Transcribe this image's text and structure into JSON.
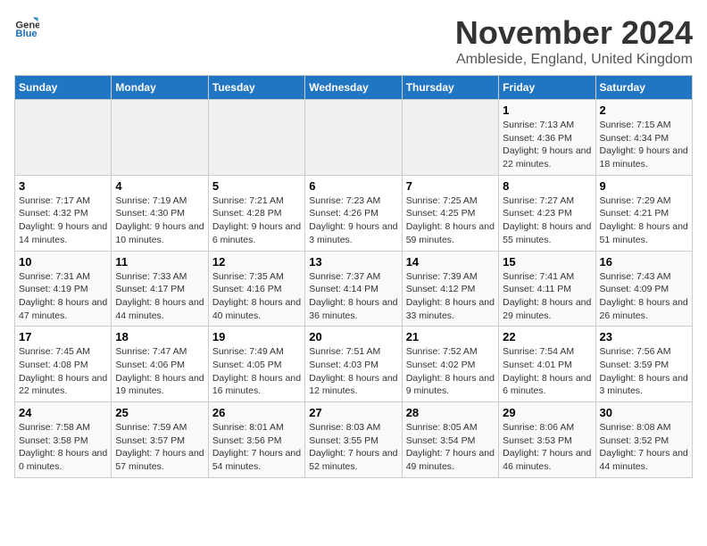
{
  "logo": {
    "general": "General",
    "blue": "Blue"
  },
  "title": "November 2024",
  "location": "Ambleside, England, United Kingdom",
  "days_of_week": [
    "Sunday",
    "Monday",
    "Tuesday",
    "Wednesday",
    "Thursday",
    "Friday",
    "Saturday"
  ],
  "weeks": [
    [
      {
        "day": "",
        "info": ""
      },
      {
        "day": "",
        "info": ""
      },
      {
        "day": "",
        "info": ""
      },
      {
        "day": "",
        "info": ""
      },
      {
        "day": "",
        "info": ""
      },
      {
        "day": "1",
        "info": "Sunrise: 7:13 AM\nSunset: 4:36 PM\nDaylight: 9 hours and 22 minutes."
      },
      {
        "day": "2",
        "info": "Sunrise: 7:15 AM\nSunset: 4:34 PM\nDaylight: 9 hours and 18 minutes."
      }
    ],
    [
      {
        "day": "3",
        "info": "Sunrise: 7:17 AM\nSunset: 4:32 PM\nDaylight: 9 hours and 14 minutes."
      },
      {
        "day": "4",
        "info": "Sunrise: 7:19 AM\nSunset: 4:30 PM\nDaylight: 9 hours and 10 minutes."
      },
      {
        "day": "5",
        "info": "Sunrise: 7:21 AM\nSunset: 4:28 PM\nDaylight: 9 hours and 6 minutes."
      },
      {
        "day": "6",
        "info": "Sunrise: 7:23 AM\nSunset: 4:26 PM\nDaylight: 9 hours and 3 minutes."
      },
      {
        "day": "7",
        "info": "Sunrise: 7:25 AM\nSunset: 4:25 PM\nDaylight: 8 hours and 59 minutes."
      },
      {
        "day": "8",
        "info": "Sunrise: 7:27 AM\nSunset: 4:23 PM\nDaylight: 8 hours and 55 minutes."
      },
      {
        "day": "9",
        "info": "Sunrise: 7:29 AM\nSunset: 4:21 PM\nDaylight: 8 hours and 51 minutes."
      }
    ],
    [
      {
        "day": "10",
        "info": "Sunrise: 7:31 AM\nSunset: 4:19 PM\nDaylight: 8 hours and 47 minutes."
      },
      {
        "day": "11",
        "info": "Sunrise: 7:33 AM\nSunset: 4:17 PM\nDaylight: 8 hours and 44 minutes."
      },
      {
        "day": "12",
        "info": "Sunrise: 7:35 AM\nSunset: 4:16 PM\nDaylight: 8 hours and 40 minutes."
      },
      {
        "day": "13",
        "info": "Sunrise: 7:37 AM\nSunset: 4:14 PM\nDaylight: 8 hours and 36 minutes."
      },
      {
        "day": "14",
        "info": "Sunrise: 7:39 AM\nSunset: 4:12 PM\nDaylight: 8 hours and 33 minutes."
      },
      {
        "day": "15",
        "info": "Sunrise: 7:41 AM\nSunset: 4:11 PM\nDaylight: 8 hours and 29 minutes."
      },
      {
        "day": "16",
        "info": "Sunrise: 7:43 AM\nSunset: 4:09 PM\nDaylight: 8 hours and 26 minutes."
      }
    ],
    [
      {
        "day": "17",
        "info": "Sunrise: 7:45 AM\nSunset: 4:08 PM\nDaylight: 8 hours and 22 minutes."
      },
      {
        "day": "18",
        "info": "Sunrise: 7:47 AM\nSunset: 4:06 PM\nDaylight: 8 hours and 19 minutes."
      },
      {
        "day": "19",
        "info": "Sunrise: 7:49 AM\nSunset: 4:05 PM\nDaylight: 8 hours and 16 minutes."
      },
      {
        "day": "20",
        "info": "Sunrise: 7:51 AM\nSunset: 4:03 PM\nDaylight: 8 hours and 12 minutes."
      },
      {
        "day": "21",
        "info": "Sunrise: 7:52 AM\nSunset: 4:02 PM\nDaylight: 8 hours and 9 minutes."
      },
      {
        "day": "22",
        "info": "Sunrise: 7:54 AM\nSunset: 4:01 PM\nDaylight: 8 hours and 6 minutes."
      },
      {
        "day": "23",
        "info": "Sunrise: 7:56 AM\nSunset: 3:59 PM\nDaylight: 8 hours and 3 minutes."
      }
    ],
    [
      {
        "day": "24",
        "info": "Sunrise: 7:58 AM\nSunset: 3:58 PM\nDaylight: 8 hours and 0 minutes."
      },
      {
        "day": "25",
        "info": "Sunrise: 7:59 AM\nSunset: 3:57 PM\nDaylight: 7 hours and 57 minutes."
      },
      {
        "day": "26",
        "info": "Sunrise: 8:01 AM\nSunset: 3:56 PM\nDaylight: 7 hours and 54 minutes."
      },
      {
        "day": "27",
        "info": "Sunrise: 8:03 AM\nSunset: 3:55 PM\nDaylight: 7 hours and 52 minutes."
      },
      {
        "day": "28",
        "info": "Sunrise: 8:05 AM\nSunset: 3:54 PM\nDaylight: 7 hours and 49 minutes."
      },
      {
        "day": "29",
        "info": "Sunrise: 8:06 AM\nSunset: 3:53 PM\nDaylight: 7 hours and 46 minutes."
      },
      {
        "day": "30",
        "info": "Sunrise: 8:08 AM\nSunset: 3:52 PM\nDaylight: 7 hours and 44 minutes."
      }
    ]
  ]
}
